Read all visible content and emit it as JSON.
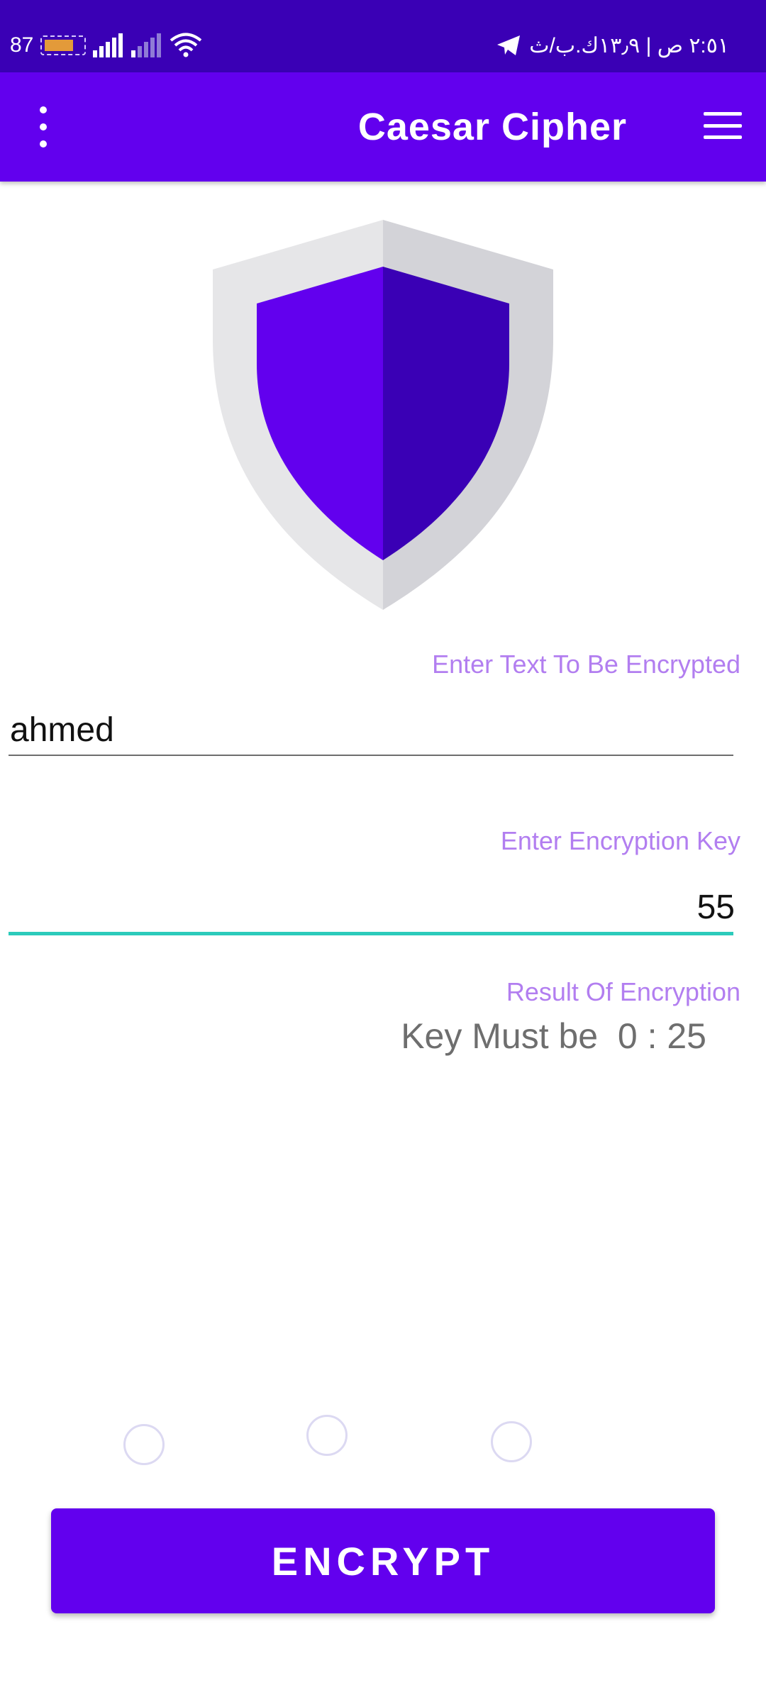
{
  "status_bar": {
    "battery": "87",
    "right_text": "٢:٥١ ص | ١٣٫٩ك.ب/ث"
  },
  "app_bar": {
    "title": "Caesar Cipher",
    "menu_icon": "kebab-menu-icon",
    "drawer_icon": "hamburger-icon"
  },
  "hero": {
    "icon": "shield-icon",
    "colors": {
      "left": "#6200ee",
      "right": "#3a00b5",
      "rim_left": "#e6e6e8",
      "rim_right": "#d3d3d8"
    }
  },
  "form": {
    "text_label": "Enter Text To Be Encrypted",
    "text_value": "ahmed",
    "key_label": "Enter Encryption Key",
    "key_value": "55",
    "result_label": "Result Of Encryption",
    "result_value": "Key Must be  0 : 25"
  },
  "page_indicator": {
    "count": 3
  },
  "actions": {
    "encrypt_label": "ENCRYPT"
  },
  "colors": {
    "primary": "#6200ee",
    "primary_dark": "#3a00b5",
    "accent": "#2ccbbb",
    "hint": "#b27ef0"
  }
}
